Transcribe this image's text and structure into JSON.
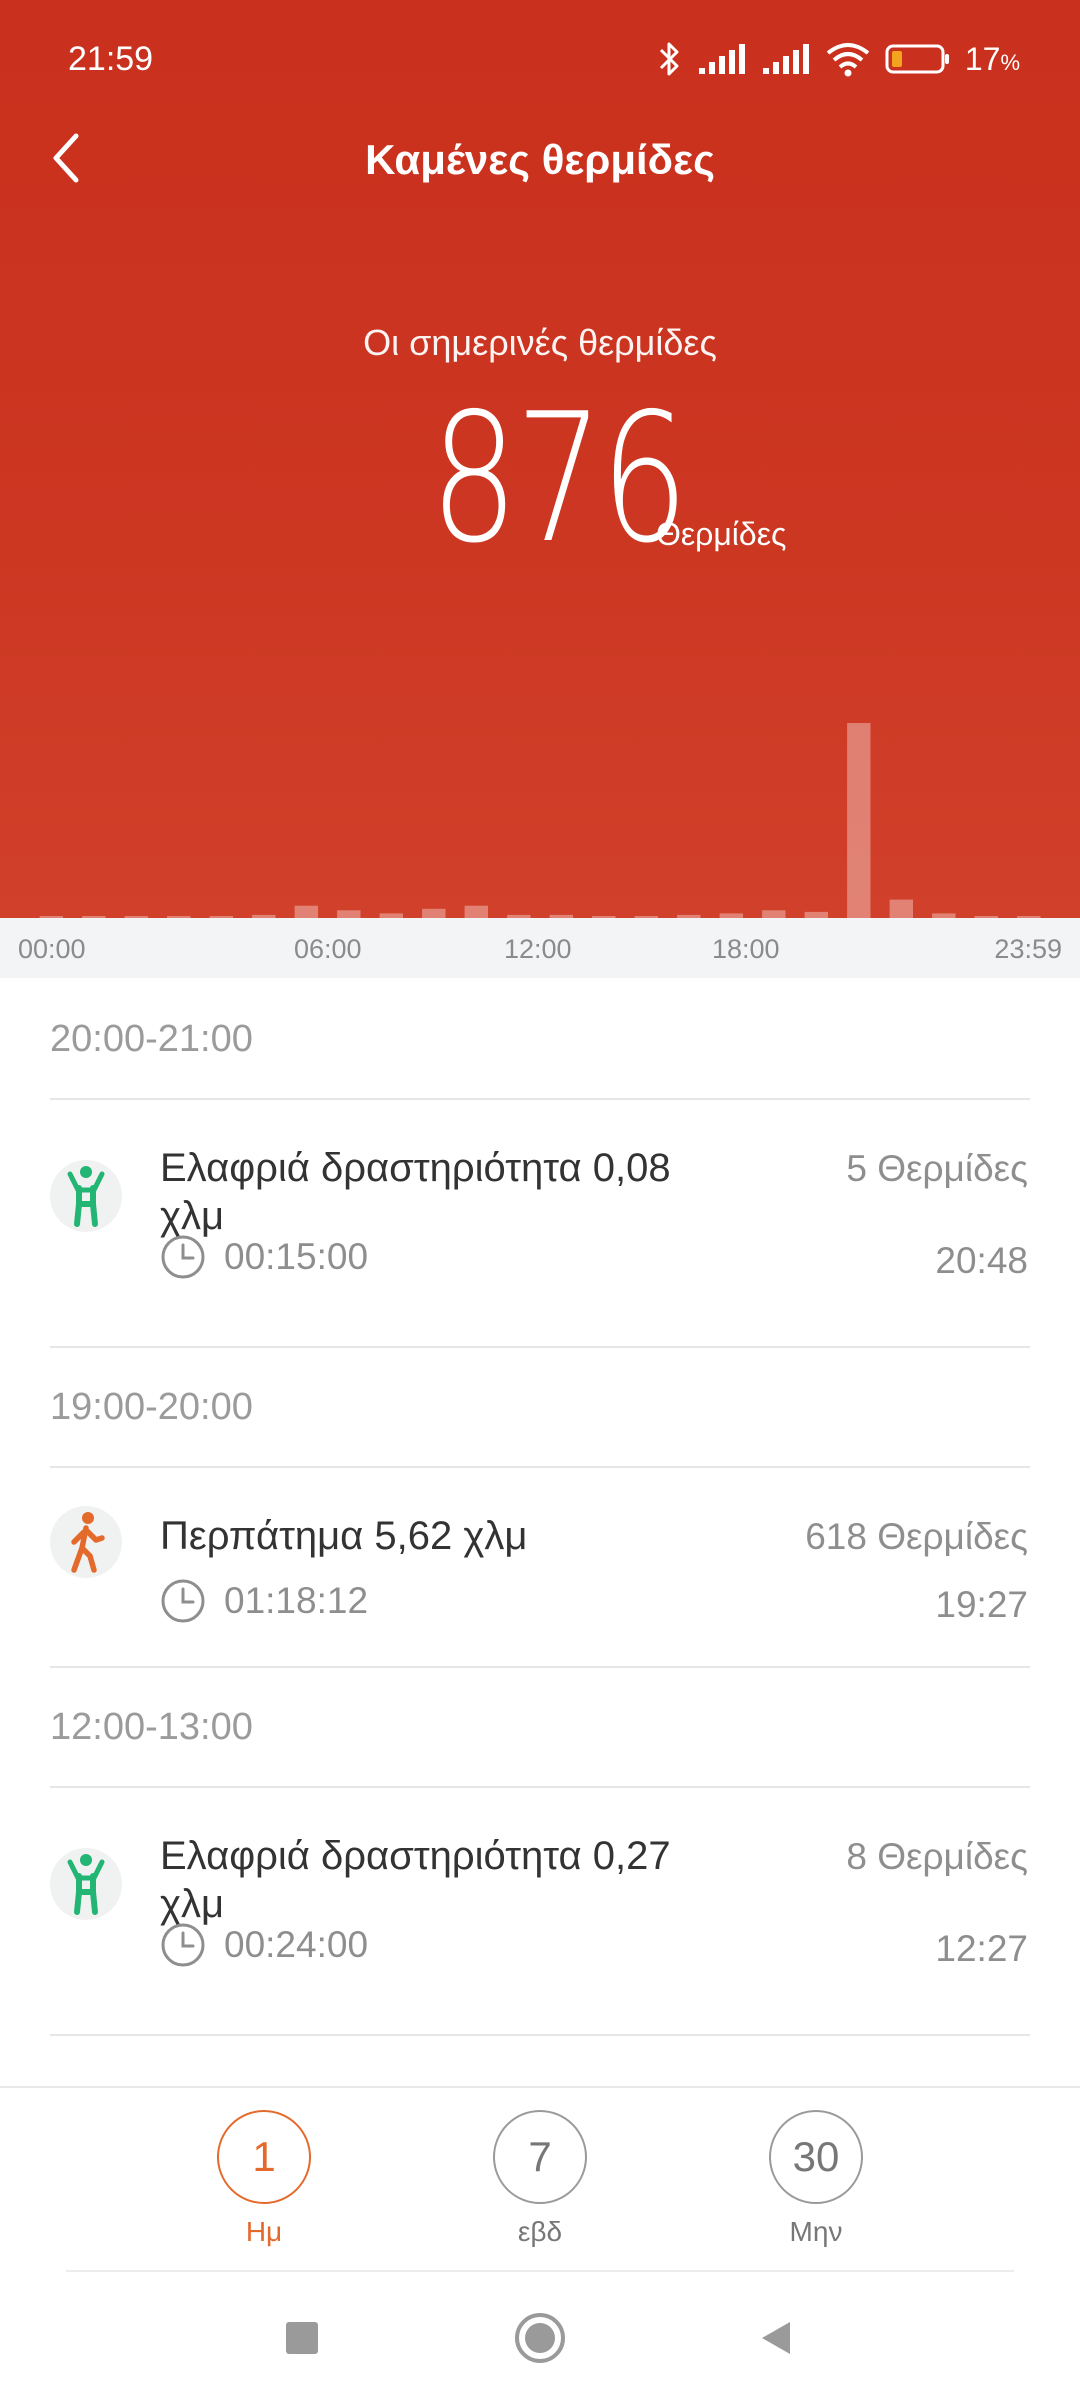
{
  "status_bar": {
    "time": "21:59",
    "battery_percent": "17",
    "battery_unit": "%"
  },
  "header": {
    "title": "Καμένες θερμίδες",
    "today_label": "Οι σημερινές θερμίδες",
    "total_value": "876",
    "total_unit": "Θερμίδες"
  },
  "chart_data": {
    "type": "bar",
    "x_ticks": [
      "00:00",
      "06:00",
      "12:00",
      "18:00",
      "23:59"
    ],
    "categories": [
      "00",
      "01",
      "02",
      "03",
      "04",
      "05",
      "06",
      "07",
      "08",
      "09",
      "10",
      "11",
      "12",
      "13",
      "14",
      "15",
      "16",
      "17",
      "18",
      "19",
      "20",
      "21",
      "22",
      "23"
    ],
    "values": [
      1,
      1,
      1,
      1,
      1,
      2,
      8,
      5,
      3,
      6,
      8,
      2,
      2,
      1,
      1,
      2,
      3,
      5,
      4,
      127,
      12,
      3,
      1,
      1
    ],
    "title": "",
    "xlabel": "",
    "ylabel": "",
    "grid": false
  },
  "sections": [
    {
      "header": "20:00-21:00",
      "items": [
        {
          "icon": "light-activity-icon",
          "title": "Ελαφριά δραστηριότητα 0,08 χλμ",
          "calories": "5 Θερμίδες",
          "duration": "00:15:00",
          "time": "20:48"
        }
      ]
    },
    {
      "header": "19:00-20:00",
      "items": [
        {
          "icon": "walking-icon",
          "title": "Περπάτημα 5,62 χλμ",
          "calories": "618 Θερμίδες",
          "duration": "01:18:12",
          "time": "19:27"
        }
      ]
    },
    {
      "header": "12:00-13:00",
      "items": [
        {
          "icon": "light-activity-icon",
          "title": "Ελαφριά δραστηριότητα 0,27 χλμ",
          "calories": "8 Θερμίδες",
          "duration": "00:24:00",
          "time": "12:27"
        }
      ]
    }
  ],
  "tabs": [
    {
      "value": "1",
      "label": "Ημ",
      "active": true
    },
    {
      "value": "7",
      "label": "εβδ",
      "active": false
    },
    {
      "value": "30",
      "label": "Μην",
      "active": false
    }
  ],
  "colors": {
    "header_bg": "#c9301d",
    "accent_orange": "#e46a2c",
    "green": "#22b573"
  }
}
